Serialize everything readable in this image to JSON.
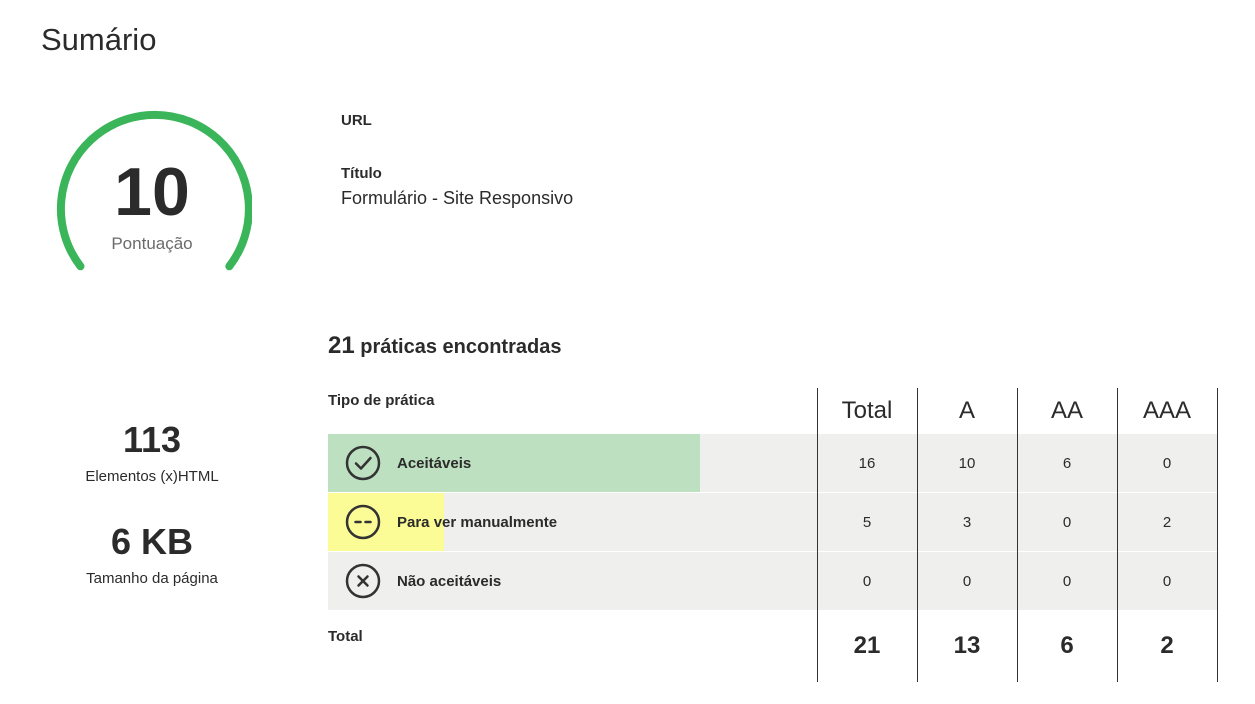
{
  "page": {
    "title": "Sumário"
  },
  "score": {
    "value": "10",
    "label": "Pontuação",
    "fraction": 1.0,
    "color": "#3bb55a"
  },
  "meta": {
    "url_label": "URL",
    "url_value": "",
    "title_label": "Título",
    "title_value": "Formulário - Site Responsivo"
  },
  "stats": {
    "elements": {
      "value": "113",
      "label": "Elementos (x)HTML"
    },
    "size": {
      "value": "6 KB",
      "label": "Tamanho da página"
    }
  },
  "practices": {
    "count": "21",
    "heading": " práticas encontradas",
    "type_header": "Tipo de prática",
    "columns": [
      "Total",
      "A",
      "AA",
      "AAA"
    ],
    "rows": [
      {
        "label": "Aceitáveis",
        "icon": "check-circle-icon",
        "color": "#bde0c0",
        "fraction": 0.762,
        "values": [
          "16",
          "10",
          "6",
          "0"
        ]
      },
      {
        "label": "Para ver manualmente",
        "icon": "minus-circle-icon",
        "color": "#fcfc96",
        "fraction": 0.238,
        "values": [
          "5",
          "3",
          "0",
          "2"
        ]
      },
      {
        "label": "Não aceitáveis",
        "icon": "x-circle-icon",
        "color": "#efefed",
        "fraction": 0.0,
        "values": [
          "0",
          "0",
          "0",
          "0"
        ]
      }
    ],
    "total_label": "Total",
    "totals": [
      "21",
      "13",
      "6",
      "2"
    ]
  }
}
